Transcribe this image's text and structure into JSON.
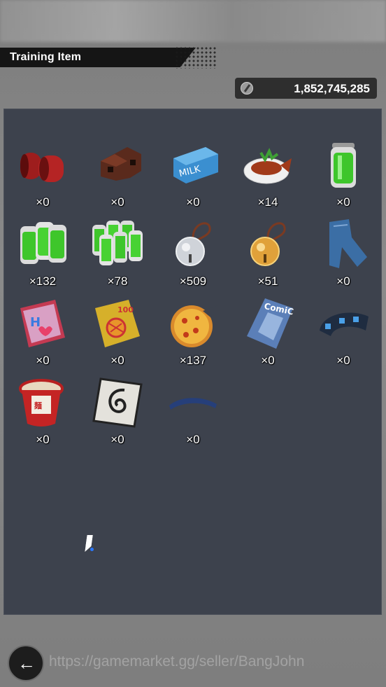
{
  "header": {
    "title": "Training Item"
  },
  "currency": {
    "icon": "coin-icon",
    "amount": "1,852,745,285"
  },
  "items": [
    {
      "name": "dumbbell",
      "count": "×0"
    },
    {
      "name": "brick",
      "count": "×0"
    },
    {
      "name": "milk-carton",
      "count": "×0"
    },
    {
      "name": "fish-dish",
      "count": "×14"
    },
    {
      "name": "energy-drink",
      "count": "×0"
    },
    {
      "name": "drink-pack-3",
      "count": "×132"
    },
    {
      "name": "drink-pack-6",
      "count": "×78"
    },
    {
      "name": "silver-bell",
      "count": "×509"
    },
    {
      "name": "gold-bell",
      "count": "×51"
    },
    {
      "name": "jeans",
      "count": "×0"
    },
    {
      "name": "magazine",
      "count": "×0"
    },
    {
      "name": "puzzle-book",
      "count": "×0"
    },
    {
      "name": "pizza",
      "count": "×137"
    },
    {
      "name": "comic-book",
      "count": "×0"
    },
    {
      "name": "wristband",
      "count": "×0"
    },
    {
      "name": "cup-noodle",
      "count": "×0"
    },
    {
      "name": "symbol-card",
      "count": "×0"
    },
    {
      "name": "headband",
      "count": "×0"
    }
  ],
  "watermark": "https://gamemarket.gg/seller/BangJohn"
}
